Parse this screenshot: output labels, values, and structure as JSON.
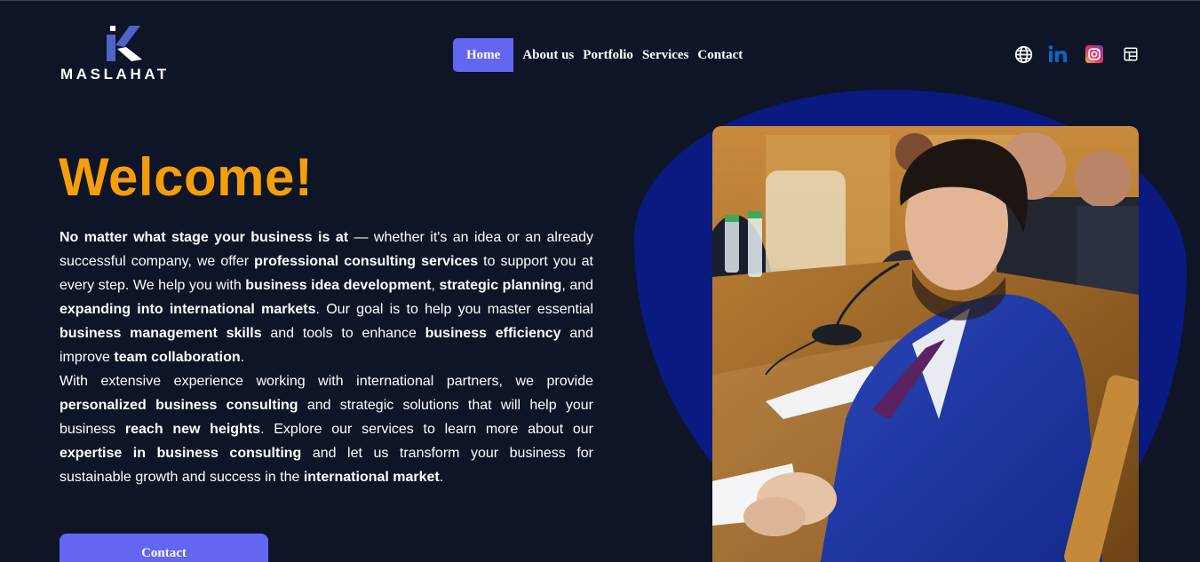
{
  "brand": {
    "name": "MASLAHAT"
  },
  "nav": {
    "items": [
      {
        "label": "Home",
        "active": true
      },
      {
        "label": "About us",
        "active": false
      },
      {
        "label": "Portfolio",
        "active": false
      },
      {
        "label": "Services",
        "active": false
      },
      {
        "label": "Contact",
        "active": false
      }
    ]
  },
  "social": {
    "icons": [
      "globe-icon",
      "linkedin-icon",
      "instagram-icon",
      "calendar-icon"
    ]
  },
  "hero": {
    "title": "Welcome!",
    "p1": [
      {
        "t": "No matter what stage your business is at",
        "b": true
      },
      {
        "t": " — whether it's an idea or an already successful company, we offer ",
        "b": false
      },
      {
        "t": "professional consulting services",
        "b": true
      },
      {
        "t": " to support you at every step. We help you with ",
        "b": false
      },
      {
        "t": "business idea development",
        "b": true
      },
      {
        "t": ", ",
        "b": false
      },
      {
        "t": "strategic planning",
        "b": true
      },
      {
        "t": ", and ",
        "b": false
      },
      {
        "t": "expanding into international markets",
        "b": true
      },
      {
        "t": ". Our goal is to help you master essential ",
        "b": false
      },
      {
        "t": "business management skills",
        "b": true
      },
      {
        "t": " and tools to enhance ",
        "b": false
      },
      {
        "t": "business efficiency",
        "b": true
      },
      {
        "t": " and improve ",
        "b": false
      },
      {
        "t": "team collaboration",
        "b": true
      },
      {
        "t": ".",
        "b": false
      }
    ],
    "p2": [
      {
        "t": "With extensive experience working with international partners, we provide ",
        "b": false
      },
      {
        "t": "personalized business consulting",
        "b": true
      },
      {
        "t": " and strategic solutions that will help your business ",
        "b": false
      },
      {
        "t": "reach new heights",
        "b": true
      },
      {
        "t": ". Explore our services to learn more about our ",
        "b": false
      },
      {
        "t": "expertise in business consulting",
        "b": true
      },
      {
        "t": " and let us transform your business for sustainable growth and success in the ",
        "b": false
      },
      {
        "t": "international market",
        "b": true
      },
      {
        "t": ".",
        "b": false
      }
    ],
    "cta_label": "Contact"
  },
  "colors": {
    "background": "#0e1526",
    "accent": "#6366f1",
    "title": "#f59e0b",
    "blob": "#0a1a80"
  }
}
